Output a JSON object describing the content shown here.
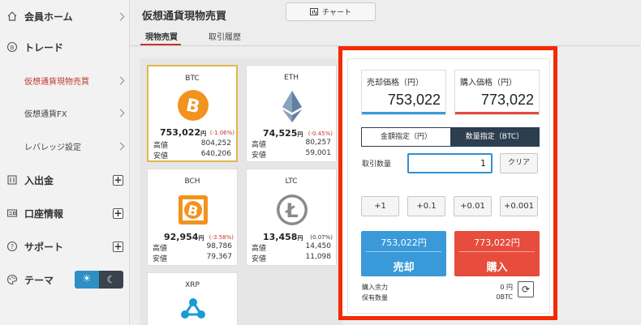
{
  "sidebar": {
    "member_home": "会員ホーム",
    "trade": "トレード",
    "spot": "仮想通貨現物売買",
    "fx": "仮想通貨FX",
    "leverage": "レバレッジ設定",
    "deposit": "入出金",
    "account": "口座情報",
    "support": "サポート",
    "theme": "テーマ"
  },
  "header": {
    "title": "仮想通貨現物売買",
    "chart_label": "チャート",
    "tabs": [
      "現物売買",
      "取引履歴"
    ]
  },
  "coins": [
    {
      "symbol": "BTC",
      "price": "753,022",
      "unit": "円",
      "change": "(-1.06%)",
      "high_label": "高値",
      "high": "804,252",
      "low_label": "安値",
      "low": "640,206",
      "color": "#f2931e"
    },
    {
      "symbol": "ETH",
      "price": "74,525",
      "unit": "円",
      "change": "(-0.45%)",
      "high_label": "高値",
      "high": "80,257",
      "low_label": "安値",
      "low": "59,001",
      "color": "#5f7a98"
    },
    {
      "symbol": "BCH",
      "price": "92,954",
      "unit": "円",
      "change": "(-3.58%)",
      "high_label": "高値",
      "high": "98,786",
      "low_label": "安値",
      "low": "79,367",
      "color": "#f2931e"
    },
    {
      "symbol": "LTC",
      "price": "13,458",
      "unit": "円",
      "change": "(0.07%)",
      "high_label": "高値",
      "high": "14,450",
      "low_label": "安値",
      "low": "11,098",
      "color": "#8a8a8a"
    },
    {
      "symbol": "XRP",
      "color": "#1b9ad8"
    }
  ],
  "trade": {
    "sell_price_label": "売却価格（円）",
    "sell_price": "753,022",
    "buy_price_label": "購入価格（円）",
    "buy_price": "773,022",
    "mode_amount": "金額指定（円）",
    "mode_qty": "数量指定（BTC）",
    "qty_label": "取引数量",
    "qty_value": "1",
    "clear": "クリア",
    "steps": [
      "+1",
      "+0.1",
      "+0.01",
      "+0.001"
    ],
    "sell_btn_price": "753,022円",
    "sell_btn_label": "売却",
    "buy_btn_price": "773,022円",
    "buy_btn_label": "購入",
    "buy_power_label": "購入余力",
    "buy_power_value": "0 円",
    "holding_label": "保有数量",
    "holding_value": "0BTC"
  },
  "colors": {
    "accent_red": "#e74c3c",
    "accent_blue": "#3a9ad9",
    "highlight_frame": "#f42a00"
  }
}
